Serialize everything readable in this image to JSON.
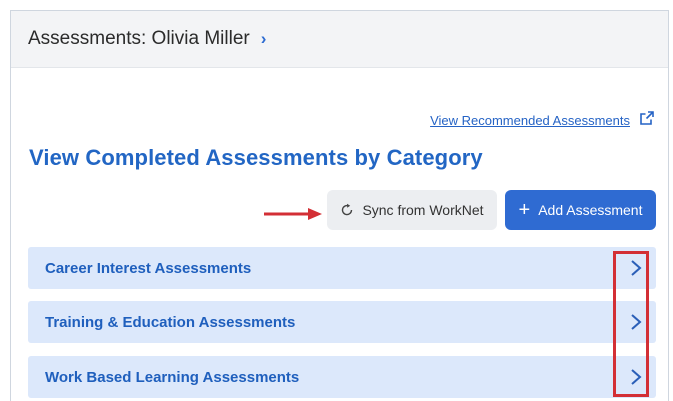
{
  "header": {
    "title": "Assessments: Olivia Miller"
  },
  "recommended_link": "View Recommended Assessments",
  "section_title": "View Completed Assessments by Category",
  "buttons": {
    "sync_label": "Sync from WorkNet",
    "add_label": "Add Assessment",
    "add_icon": "+"
  },
  "categories": [
    {
      "label": "Career Interest Assessments"
    },
    {
      "label": "Training & Education Assessments"
    },
    {
      "label": "Work Based Learning Assessments"
    }
  ],
  "colors": {
    "accent": "#2266c4",
    "primary_button": "#2f6bd2",
    "category_bg": "#dce8fb",
    "annotation_red": "#d32f35"
  },
  "icons": [
    "chevron-right-icon",
    "external-link-icon",
    "refresh-icon",
    "plus-icon",
    "red-arrow-annotation"
  ]
}
